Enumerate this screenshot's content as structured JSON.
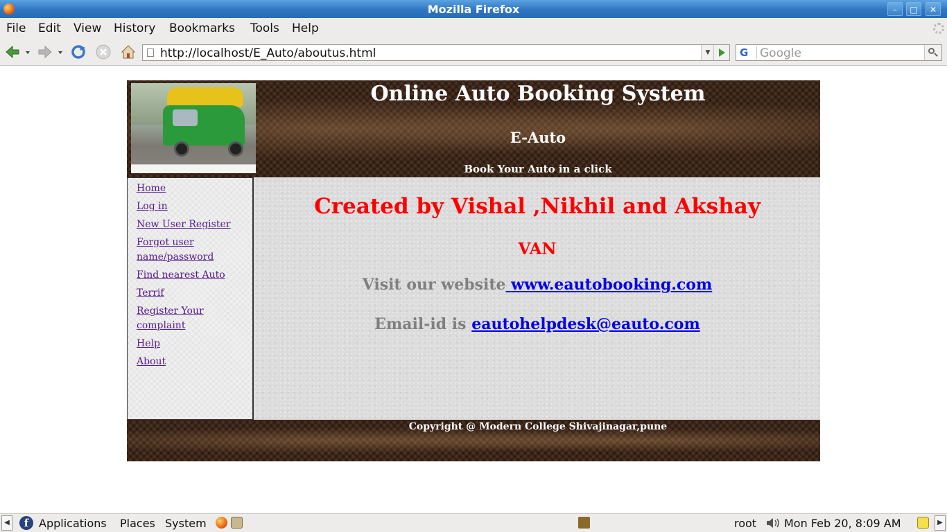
{
  "window": {
    "title": "Mozilla Firefox"
  },
  "menu": {
    "file": "File",
    "edit": "Edit",
    "view": "View",
    "history": "History",
    "bookmarks": "Bookmarks",
    "tools": "Tools",
    "help": "Help"
  },
  "toolbar": {
    "url": "http://localhost/E_Auto/aboutus.html",
    "search_placeholder": "Google",
    "search_engine": "G"
  },
  "site": {
    "title": "Online Auto Booking System",
    "subtitle": "E-Auto",
    "tagline": "Book Your Auto in a click",
    "nav": [
      {
        "label": "Home"
      },
      {
        "label": "Log in"
      },
      {
        "label": "New User Register"
      },
      {
        "label": "Forgot user name/password"
      },
      {
        "label": "Find nearest Auto"
      },
      {
        "label": "Terrif"
      },
      {
        "label": "Register Your complaint"
      },
      {
        "label": "Help"
      },
      {
        "label": "About"
      }
    ],
    "content": {
      "created_by": "Created by Vishal ,Nikhil and Akshay",
      "team": "VAN",
      "visit_label": "Visit our website",
      "website": " www.eautobooking.com",
      "email_label": "Email-id is ",
      "email": "eautohelpdesk@eauto.com"
    },
    "footer": "Copyright @ Modern College Shivajinagar,pune"
  },
  "panel": {
    "applications": "Applications",
    "places": "Places",
    "system": "System",
    "user": "root",
    "clock": "Mon Feb 20,  8:09 AM"
  },
  "colors": {
    "created_by": "#ff0000",
    "label_gray": "#808080",
    "link": "#0000ee",
    "nav_link": "#551a8b"
  }
}
